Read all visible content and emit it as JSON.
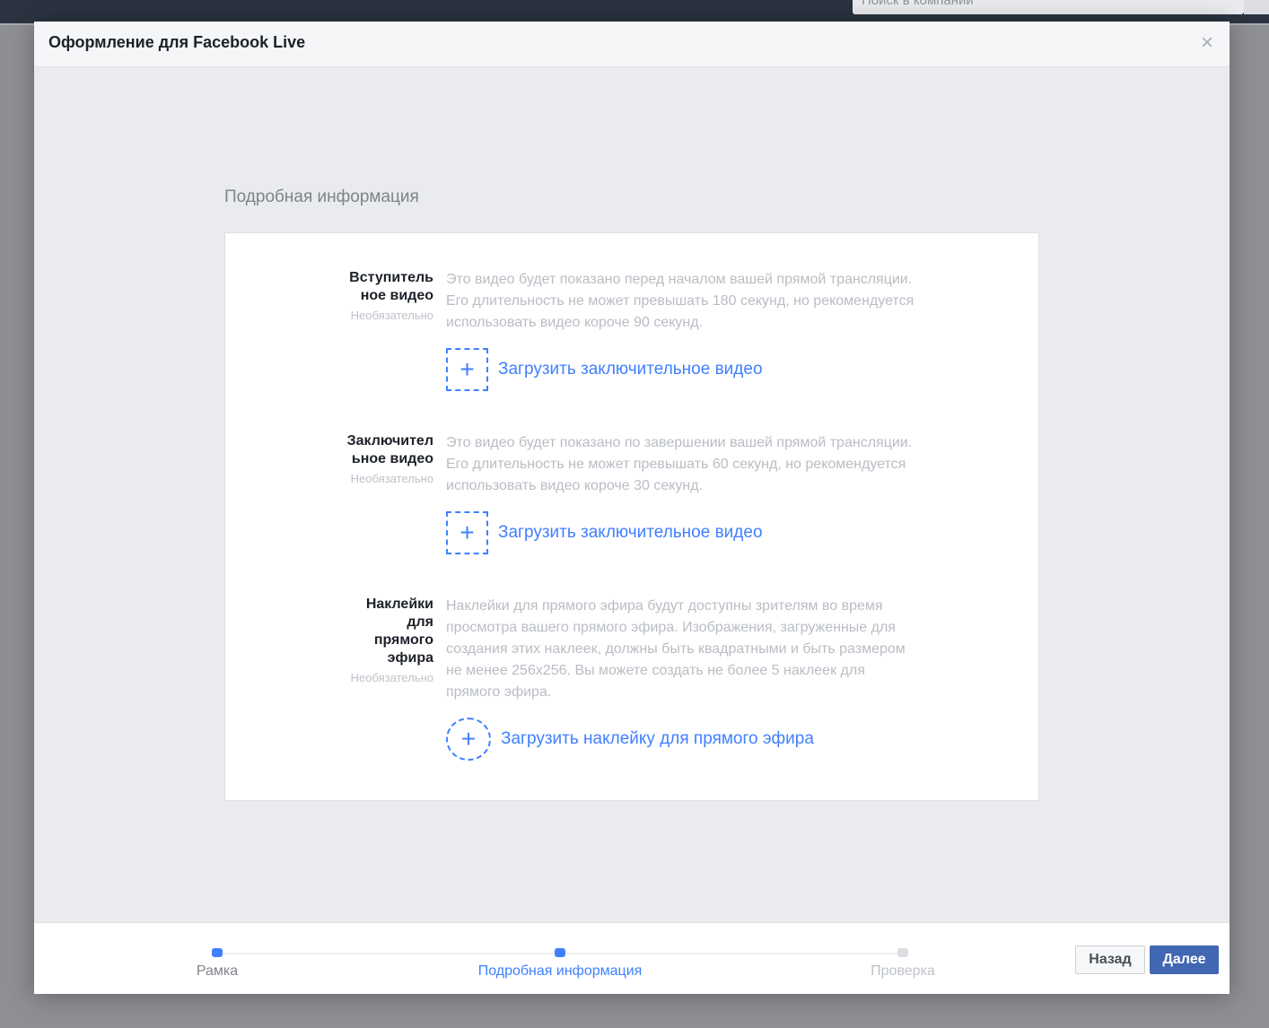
{
  "topbar": {
    "search_placeholder": "Поиск в компании"
  },
  "dialog": {
    "title": "Оформление для Facebook Live",
    "close_icon": "×"
  },
  "section_title": "Подробная информация",
  "rows": [
    {
      "label": "Вступитель ное видео",
      "optional": "Необязательно",
      "description": "Это видео будет показано перед началом вашей прямой трансляции. Его длительность не может превышать 180 секунд, но рекомендуется использовать видео короче 90 секунд.",
      "upload_label": "Загрузить заключительное видео",
      "upload_icon": "+"
    },
    {
      "label": "Заключител ьное видео",
      "optional": "Необязательно",
      "description": "Это видео будет показано по завершении вашей прямой трансляции. Его длительность не может превышать 60 секунд, но рекомендуется использовать видео короче 30 секунд.",
      "upload_label": "Загрузить заключительное видео",
      "upload_icon": "+"
    },
    {
      "label": "Наклейки для прямого эфира",
      "optional": "Необязательно",
      "description": "Наклейки для прямого эфира будут доступны зрителям во время просмотра вашего прямого эфира. Изображения, загруженные для создания этих наклеек, должны быть квадратными и быть размером не менее 256x256. Вы можете создать не более 5 наклеек для прямого эфира.",
      "upload_label": "Загрузить наклейку для прямого эфира",
      "upload_icon": "+"
    }
  ],
  "steps": [
    {
      "label": "Рамка",
      "state": "completed"
    },
    {
      "label": "Подробная информация",
      "state": "current"
    },
    {
      "label": "Проверка",
      "state": "upcoming"
    }
  ],
  "buttons": {
    "back": "Назад",
    "next": "Далее"
  },
  "colors": {
    "accent": "#4080ff",
    "primary_button": "#4267b2",
    "inactive": "#bec2c9"
  }
}
